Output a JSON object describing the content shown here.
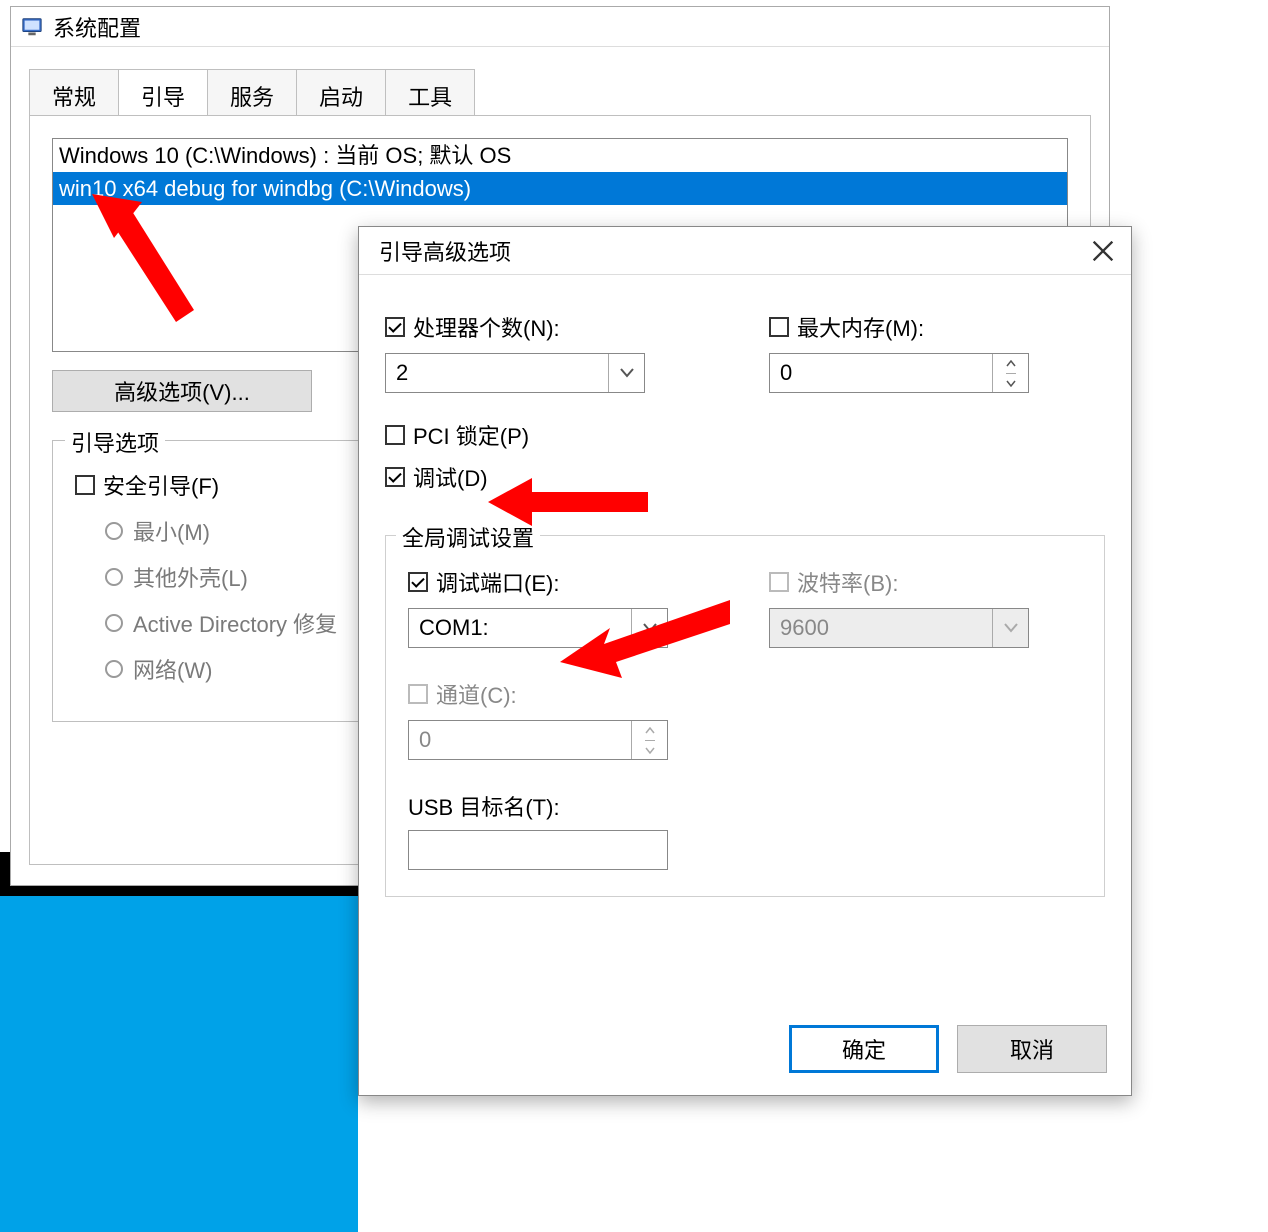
{
  "main": {
    "title": "系统配置",
    "tabs": [
      "常规",
      "引导",
      "服务",
      "启动",
      "工具"
    ],
    "active_tab": 1,
    "boot_entries": [
      "Windows 10 (C:\\Windows) : 当前 OS; 默认 OS",
      "win10 x64 debug for windbg (C:\\Windows)"
    ],
    "selected_boot_index": 1,
    "advanced_button": "高级选项(V)...",
    "boot_options": {
      "legend": "引导选项",
      "safe_boot": "安全引导(F)",
      "radios": [
        "最小(M)",
        "其他外壳(L)",
        "Active Directory 修复",
        "网络(W)"
      ]
    }
  },
  "dialog": {
    "title": "引导高级选项",
    "processors_label": "处理器个数(N):",
    "processors_value": "2",
    "max_mem_label": "最大内存(M):",
    "max_mem_value": "0",
    "pci_lock_label": "PCI 锁定(P)",
    "debug_label": "调试(D)",
    "global": {
      "legend": "全局调试设置",
      "debug_port_label": "调试端口(E):",
      "debug_port_value": "COM1:",
      "baud_label": "波特率(B):",
      "baud_value": "9600",
      "channel_label": "通道(C):",
      "channel_value": "0",
      "usb_label": "USB 目标名(T):",
      "usb_value": ""
    },
    "ok": "确定",
    "cancel": "取消"
  }
}
